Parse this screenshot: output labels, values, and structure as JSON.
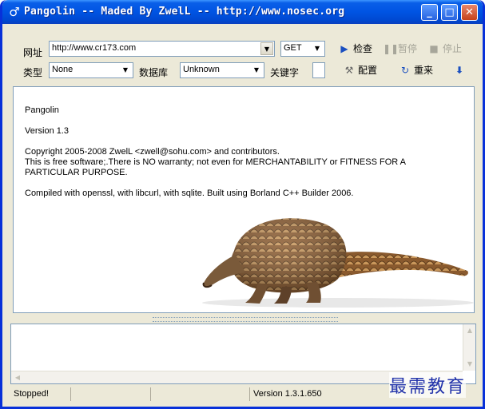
{
  "window": {
    "title": "Pangolin -- Maded By ZwelL -- http://www.nosec.org",
    "min_glyph": "_",
    "max_glyph": "□",
    "close_glyph": "✕"
  },
  "toolbar": {
    "url_label": "网址",
    "url_value": "http://www.cr173.com",
    "method_value": "GET",
    "check_label": "检查",
    "pause_label": "暂停",
    "stop_label": "停止",
    "type_label": "类型",
    "type_value": "None",
    "db_label": "数据库",
    "db_value": "Unknown",
    "keyword_label": "关键字",
    "config_label": "配置",
    "restart_label": "重来"
  },
  "info": {
    "line1": "Pangolin",
    "line2": "Version 1.3",
    "line3": "Copyright 2005-2008 ZwelL <zwell@sohu.com> and contributors.",
    "line4": "This is free software;.There is NO warranty; not even for MERCHANTABILITY or FITNESS FOR A",
    "line5": "PARTICULAR PURPOSE.",
    "line6": "Compiled with openssl, with libcurl, with sqlite. Built using Borland C++ Builder 2006."
  },
  "status": {
    "state": "Stopped!",
    "version": "Version 1.3.1.650"
  },
  "watermark": "最需教育",
  "colors": {
    "titlebar": "#0054e3",
    "frame": "#0831d9",
    "face": "#ece9d8",
    "pangolin_scale": "#9b6a3a"
  }
}
